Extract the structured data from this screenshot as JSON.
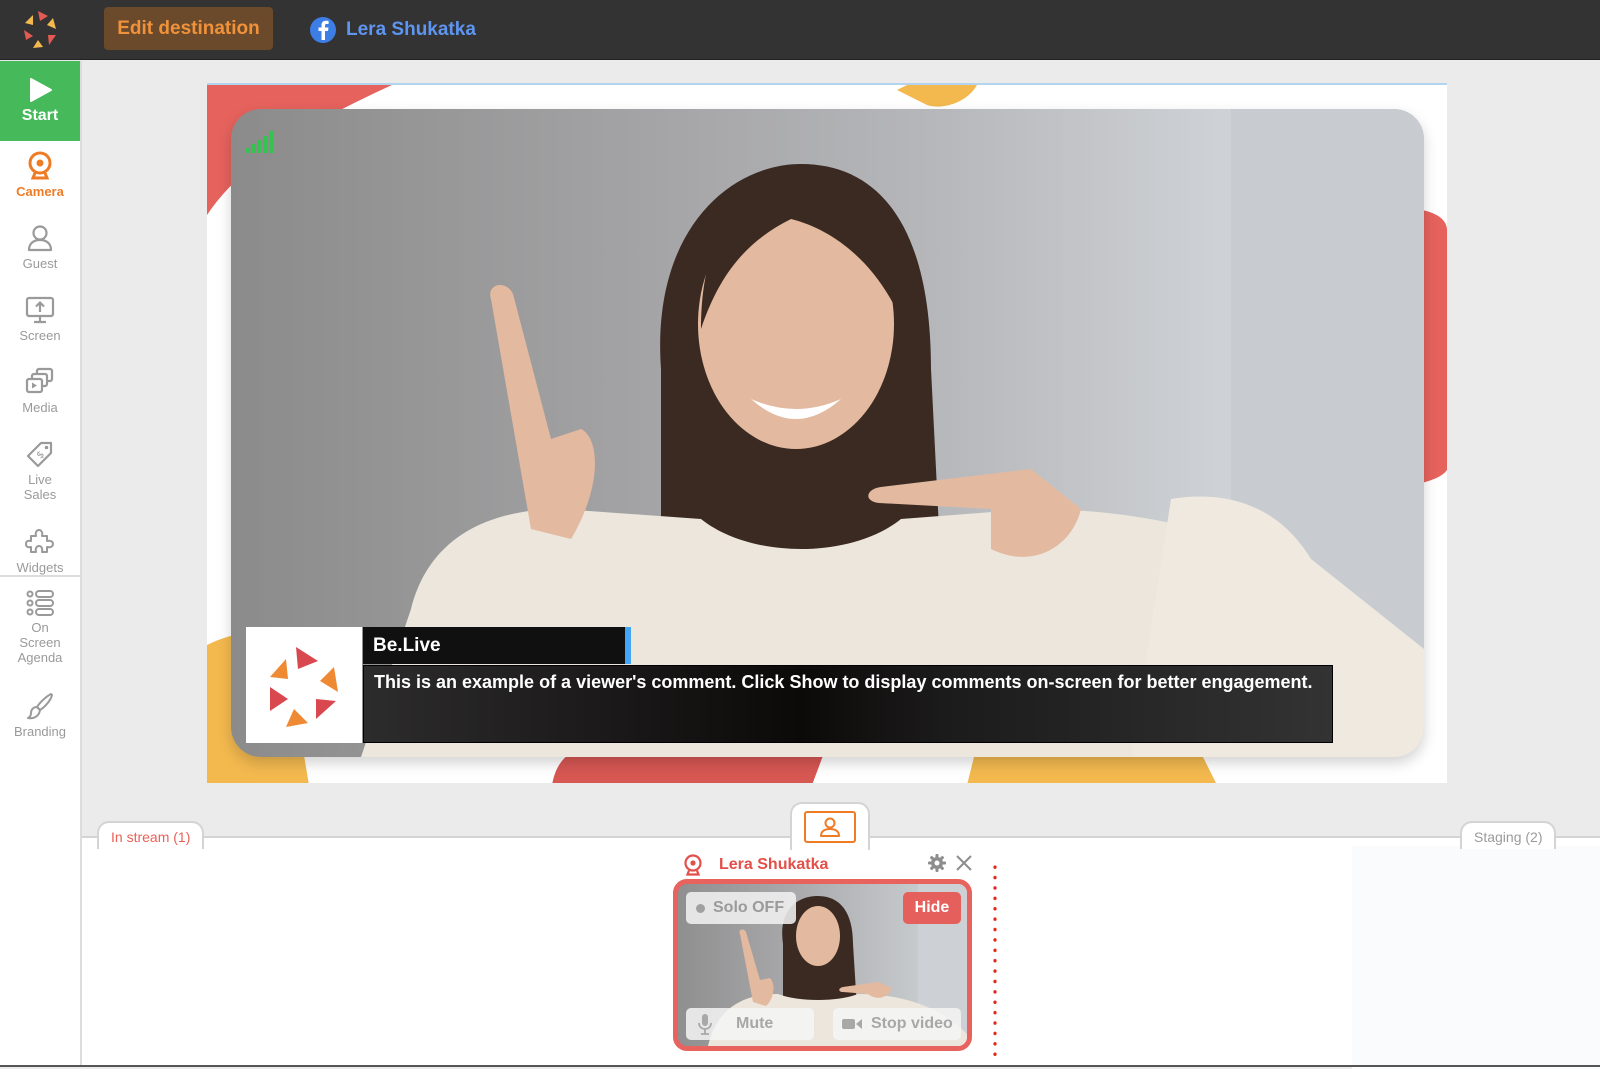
{
  "topbar": {
    "logo_icon": "belive-logo-icon",
    "edit_destination_label": "Edit destination",
    "destination": {
      "platform_icon": "facebook-icon",
      "name": "Lera Shukatka"
    }
  },
  "sidebar": {
    "start_label": "Start",
    "items": [
      {
        "label": "Camera",
        "icon": "webcam-icon",
        "active": true
      },
      {
        "label": "Guest",
        "icon": "person-icon",
        "active": false
      },
      {
        "label": "Screen",
        "icon": "screen-share-icon",
        "active": false
      },
      {
        "label": "Media",
        "icon": "media-stack-icon",
        "active": false
      },
      {
        "label": "Live Sales",
        "icon": "price-tag-icon",
        "active": false
      },
      {
        "label": "Widgets",
        "icon": "puzzle-icon",
        "active": false
      },
      {
        "label": "On Screen Agenda",
        "icon": "list-icon",
        "active": false
      },
      {
        "label": "Branding",
        "icon": "brush-icon",
        "active": false
      }
    ]
  },
  "stage": {
    "signal_strength_bars": 5,
    "lower_third": {
      "brand_name": "Be.Live",
      "comment": "This is an example of a viewer's comment. Click Show to display comments on-screen for better engagement."
    }
  },
  "tray": {
    "tabs": {
      "in_stream": "In stream (1)",
      "staging": "Staging (2)"
    },
    "guest": {
      "name": "Lera Shukatka",
      "solo_label": "Solo OFF",
      "hide_label": "Hide",
      "mute_label": "Mute",
      "stop_video_label": "Stop video"
    }
  },
  "colors": {
    "topbar_bg": "#333333",
    "accent_orange": "#ef7b25",
    "start_green": "#46b95a",
    "brand_red": "#e8625e",
    "brand_yellow": "#f3b94f",
    "facebook_blue": "#5d95f0"
  }
}
